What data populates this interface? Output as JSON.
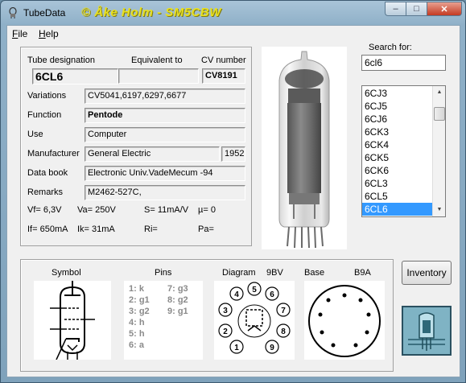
{
  "window": {
    "title": "TubeData",
    "banner": "© Åke Holm - SM5CBW",
    "controls": {
      "minimize": "–",
      "maximize": "□",
      "close": "✕"
    }
  },
  "menu": [
    {
      "label": "File",
      "mnemonic": "F",
      "rest": "ile"
    },
    {
      "label": "Help",
      "mnemonic": "H",
      "rest": "elp"
    }
  ],
  "tube": {
    "designation_label": "Tube designation",
    "designation": "6CL6",
    "equivalent_label": "Equivalent to",
    "equivalent": "",
    "cv_label": "CV number",
    "cv": "CV8191",
    "variations_label": "Variations",
    "variations": "CV5041,6197,6297,6677",
    "function_label": "Function",
    "function": "Pentode",
    "use_label": "Use",
    "use": "Computer",
    "manufacturer_label": "Manufacturer",
    "manufacturer": "General Electric",
    "year": "1952",
    "databook_label": "Data book",
    "databook": "Electronic Univ.VadeMecum -94",
    "remarks_label": "Remarks",
    "remarks": "M2462-527C,"
  },
  "params": {
    "vf": "Vf= 6,3V",
    "va": "Va=  250V",
    "s": "S= 11mA/V",
    "mu": "µ=   0",
    "if": "If= 650mA",
    "ik": "Ik=  31mA",
    "ri": "Ri=",
    "pa": "Pa="
  },
  "search": {
    "label": "Search for:",
    "value": "6cl6"
  },
  "list": {
    "items": [
      "6CJ3",
      "6CJ5",
      "6CJ6",
      "6CK3",
      "6CK4",
      "6CK5",
      "6CK6",
      "6CL3",
      "6CL5",
      "6CL6"
    ],
    "selected": "6CL6"
  },
  "bottom": {
    "symbol_label": "Symbol",
    "pins_label": "Pins",
    "diagram_label": "Diagram",
    "diagram_code": "9BV",
    "base_label": "Base",
    "base_code": "B9A",
    "pins": [
      "1: k",
      "2: g1",
      "3: g2",
      "4: h",
      "5: h",
      "6: a",
      "7: g3",
      "8: g2",
      "9: g1"
    ],
    "diagram_pins": [
      "5",
      "6",
      "4",
      "7",
      "3",
      "8",
      "2",
      "9",
      "1"
    ]
  },
  "inventory_button": "Inventory",
  "colors": {
    "selection": "#3399ff",
    "banner": "#e8e020",
    "pins_text": "#8a8a8a"
  }
}
